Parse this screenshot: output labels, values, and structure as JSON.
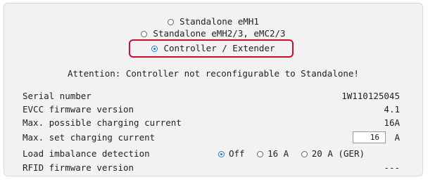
{
  "mode_options": [
    {
      "label": "Standalone eMH1",
      "selected": false
    },
    {
      "label": "Standalone eMH2/3, eMC2/3",
      "selected": false
    },
    {
      "label": "Controller / Extender",
      "selected": true
    }
  ],
  "attention": "Attention: Controller not reconfigurable to Standalone!",
  "info": {
    "serial_label": "Serial number",
    "serial_value": "1W110125045",
    "evcc_label": "EVCC firmware version",
    "evcc_value": "4.1",
    "max_possible_label": "Max. possible charging current",
    "max_possible_value": "16A",
    "max_set_label": "Max. set charging current",
    "max_set_value": "16",
    "max_set_unit": "A",
    "load_imbalance_label": "Load imbalance detection",
    "load_imbalance_options": [
      {
        "label": "Off",
        "selected": true
      },
      {
        "label": "16 A",
        "selected": false
      },
      {
        "label": "20 A (GER)",
        "selected": false
      }
    ],
    "rfid_label": "RFID firmware version",
    "rfid_value": "---"
  },
  "colors": {
    "accent": "#1a73e8",
    "highlight": "#c8102e"
  }
}
